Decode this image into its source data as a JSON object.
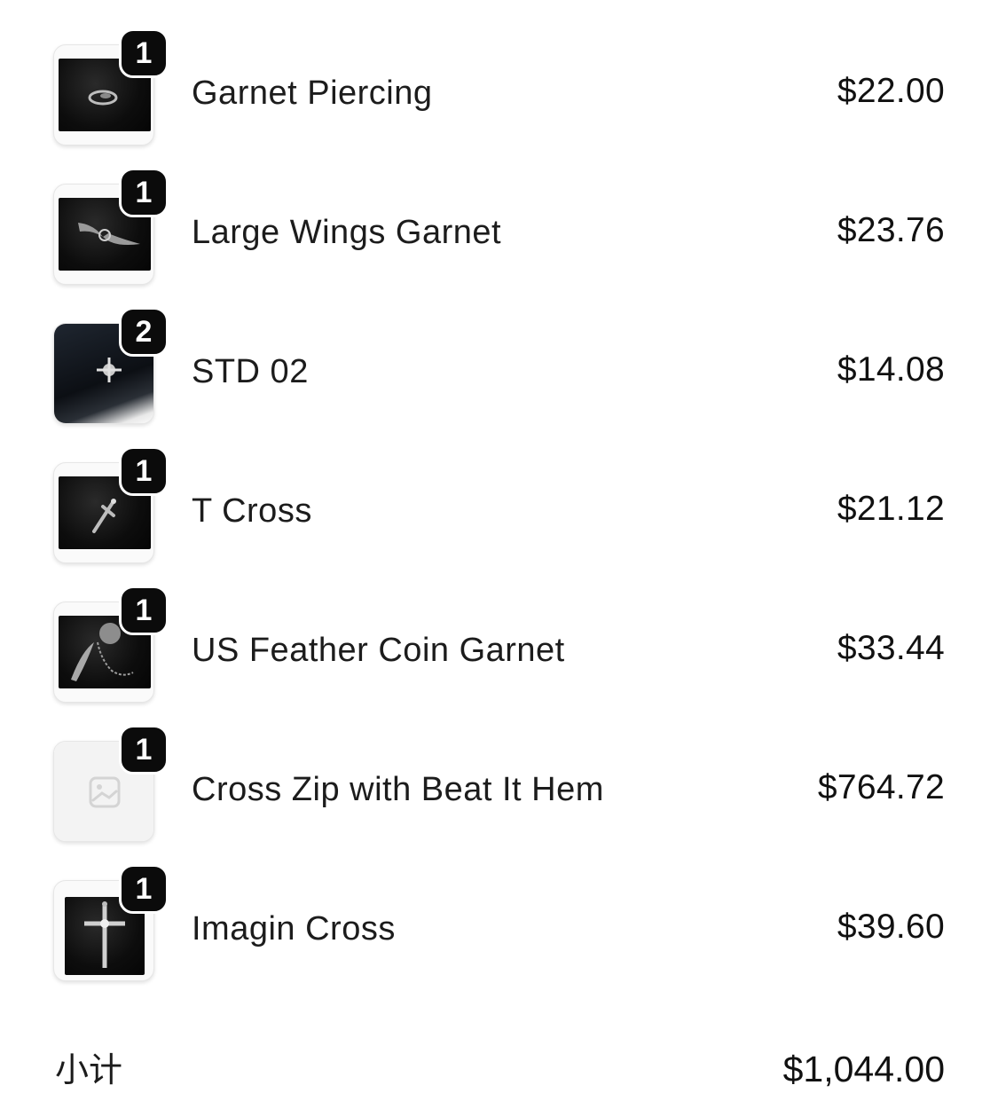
{
  "line_items": [
    {
      "title": "Garnet Piercing",
      "quantity": "1",
      "price": "$22.00",
      "image": "ring-jewelry-image"
    },
    {
      "title": "Large Wings Garnet",
      "quantity": "1",
      "price": "$23.76",
      "image": "wings-pendant-image"
    },
    {
      "title": "STD 02",
      "quantity": "2",
      "price": "$14.08",
      "image": "leather-cross-stud-image"
    },
    {
      "title": "T Cross",
      "quantity": "1",
      "price": "$21.12",
      "image": "t-cross-pendant-image"
    },
    {
      "title": "US Feather Coin Garnet",
      "quantity": "1",
      "price": "$33.44",
      "image": "feather-coin-chain-image"
    },
    {
      "title": "Cross Zip with Beat It Hem",
      "quantity": "1",
      "price": "$764.72",
      "image": "image-placeholder-icon"
    },
    {
      "title": "Imagin Cross",
      "quantity": "1",
      "price": "$39.60",
      "image": "ornate-cross-pendant-image"
    }
  ],
  "subtotal": {
    "label": "小计",
    "value": "$1,044.00"
  },
  "colors": {
    "badge_background": "#0b0b0b",
    "badge_text": "#ffffff",
    "text": "#1c1c1c",
    "thumbnail_border": "#e6e6e6"
  }
}
